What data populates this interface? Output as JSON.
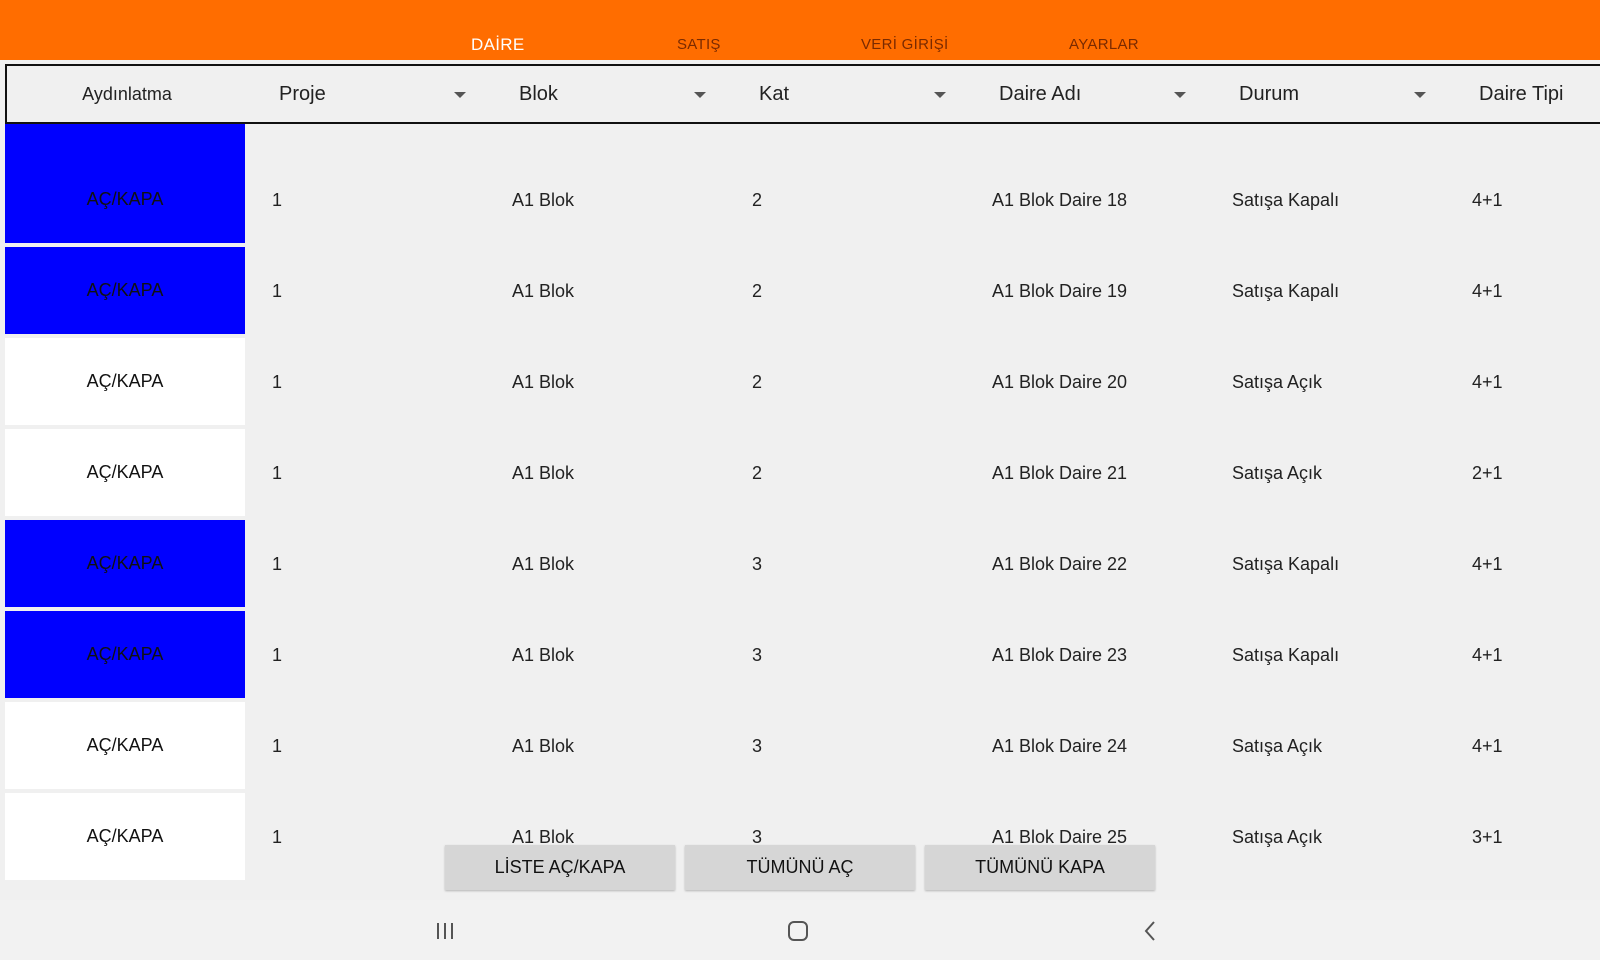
{
  "nav": {
    "tabs": [
      {
        "label": "DAİRE",
        "active": true
      },
      {
        "label": "SATIŞ",
        "active": false
      },
      {
        "label": "VERİ GİRİŞİ",
        "active": false
      },
      {
        "label": "AYARLAR",
        "active": false
      }
    ],
    "accent_color": "#ff6d00"
  },
  "table": {
    "headers": [
      "Aydınlatma",
      "Proje",
      "Blok",
      "Kat",
      "Daire Adı",
      "Durum",
      "Daire Tipi"
    ],
    "on_color": "#0000ff",
    "rows": [
      {
        "toggle": "AÇ/KAPA",
        "lit": true,
        "proje": "1",
        "blok": "A1 Blok",
        "kat": "2",
        "daire": "A1 Blok Daire 18",
        "durum": "Satışa Kapalı",
        "tip": "4+1"
      },
      {
        "toggle": "AÇ/KAPA",
        "lit": true,
        "proje": "1",
        "blok": "A1 Blok",
        "kat": "2",
        "daire": "A1 Blok Daire 19",
        "durum": "Satışa Kapalı",
        "tip": "4+1"
      },
      {
        "toggle": "AÇ/KAPA",
        "lit": false,
        "proje": "1",
        "blok": "A1 Blok",
        "kat": "2",
        "daire": "A1 Blok Daire 20",
        "durum": "Satışa Açık",
        "tip": "4+1"
      },
      {
        "toggle": "AÇ/KAPA",
        "lit": false,
        "proje": "1",
        "blok": "A1 Blok",
        "kat": "2",
        "daire": "A1 Blok Daire 21",
        "durum": "Satışa Açık",
        "tip": "2+1"
      },
      {
        "toggle": "AÇ/KAPA",
        "lit": true,
        "proje": "1",
        "blok": "A1 Blok",
        "kat": "3",
        "daire": "A1 Blok Daire 22",
        "durum": "Satışa Kapalı",
        "tip": "4+1"
      },
      {
        "toggle": "AÇ/KAPA",
        "lit": true,
        "proje": "1",
        "blok": "A1 Blok",
        "kat": "3",
        "daire": "A1 Blok Daire 23",
        "durum": "Satışa Kapalı",
        "tip": "4+1"
      },
      {
        "toggle": "AÇ/KAPA",
        "lit": false,
        "proje": "1",
        "blok": "A1 Blok",
        "kat": "3",
        "daire": "A1 Blok Daire 24",
        "durum": "Satışa Açık",
        "tip": "4+1"
      },
      {
        "toggle": "AÇ/KAPA",
        "lit": false,
        "proje": "1",
        "blok": "A1 Blok",
        "kat": "3",
        "daire": "A1 Blok Daire 25",
        "durum": "Satışa Açık",
        "tip": "3+1"
      }
    ]
  },
  "actions": {
    "list_toggle": "LİSTE AÇ/KAPA",
    "all_on": "TÜMÜNÜ AÇ",
    "all_off": "TÜMÜNÜ KAPA"
  },
  "system_nav": {
    "icons": [
      "recents-icon",
      "home-icon",
      "back-icon"
    ]
  }
}
